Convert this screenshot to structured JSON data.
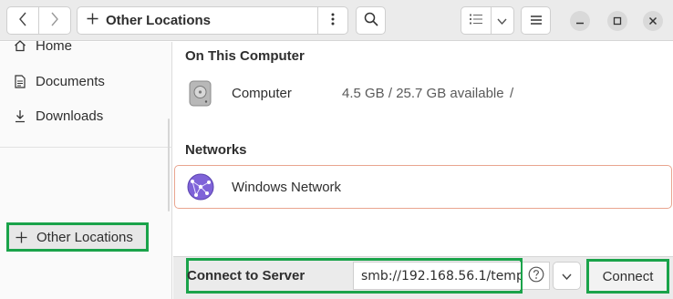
{
  "header": {
    "path_label": "Other Locations",
    "icons": {
      "back": "chevron-left-icon",
      "forward": "chevron-right-icon",
      "add": "plus-icon",
      "path_menu": "vertical-dots-icon",
      "search": "search-icon",
      "list_view": "list-view-icon",
      "view_options": "chevron-down-icon",
      "main_menu": "hamburger-icon",
      "minimize": "minimize-icon",
      "maximize": "maximize-icon",
      "close": "close-icon"
    }
  },
  "sidebar": {
    "items": [
      {
        "label": "Home",
        "icon": "home-icon"
      },
      {
        "label": "Documents",
        "icon": "document-icon"
      },
      {
        "label": "Downloads",
        "icon": "download-icon"
      }
    ],
    "other_locations": {
      "label": "Other Locations",
      "icon": "plus-icon"
    }
  },
  "main": {
    "on_this_computer": {
      "title": "On This Computer",
      "items": [
        {
          "name": "Computer",
          "info": "4.5 GB / 25.7 GB available",
          "mount": "/",
          "icon": "hard-drive-icon"
        }
      ]
    },
    "networks": {
      "title": "Networks",
      "items": [
        {
          "name": "Windows Network",
          "icon": "network-globe-icon"
        }
      ]
    }
  },
  "connect_bar": {
    "label": "Connect to Server",
    "server_value": "smb://192.168.56.1/temp",
    "connect_label": "Connect",
    "icons": {
      "help": "question-circle-icon",
      "dropdown": "chevron-down-icon"
    }
  },
  "colors": {
    "highlight_outline": "#1aa34a",
    "network_row_border": "#e9a58f",
    "header_bg": "#ebebeb"
  }
}
